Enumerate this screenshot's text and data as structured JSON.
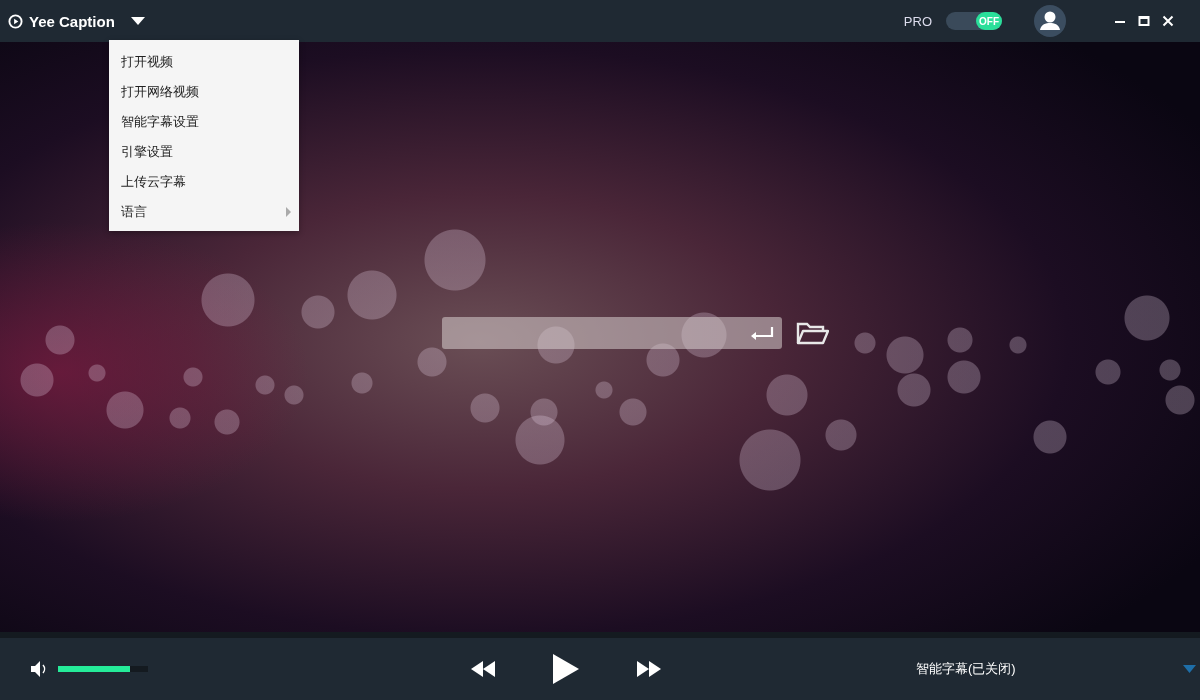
{
  "window": {
    "title": "Yee Caption"
  },
  "pro_toggle": {
    "label": "PRO",
    "state_text": "OFF",
    "on": false
  },
  "menu": {
    "items": [
      {
        "label": "打开视频",
        "has_submenu": false
      },
      {
        "label": "打开网络视频",
        "has_submenu": false
      },
      {
        "label": "智能字幕设置",
        "has_submenu": false
      },
      {
        "label": "引擎设置",
        "has_submenu": false
      },
      {
        "label": "上传云字幕",
        "has_submenu": false
      },
      {
        "label": "语言",
        "has_submenu": true
      }
    ]
  },
  "player": {
    "volume": {
      "level": 0.8
    },
    "subtitle_status": "智能字幕(已关闭)"
  }
}
